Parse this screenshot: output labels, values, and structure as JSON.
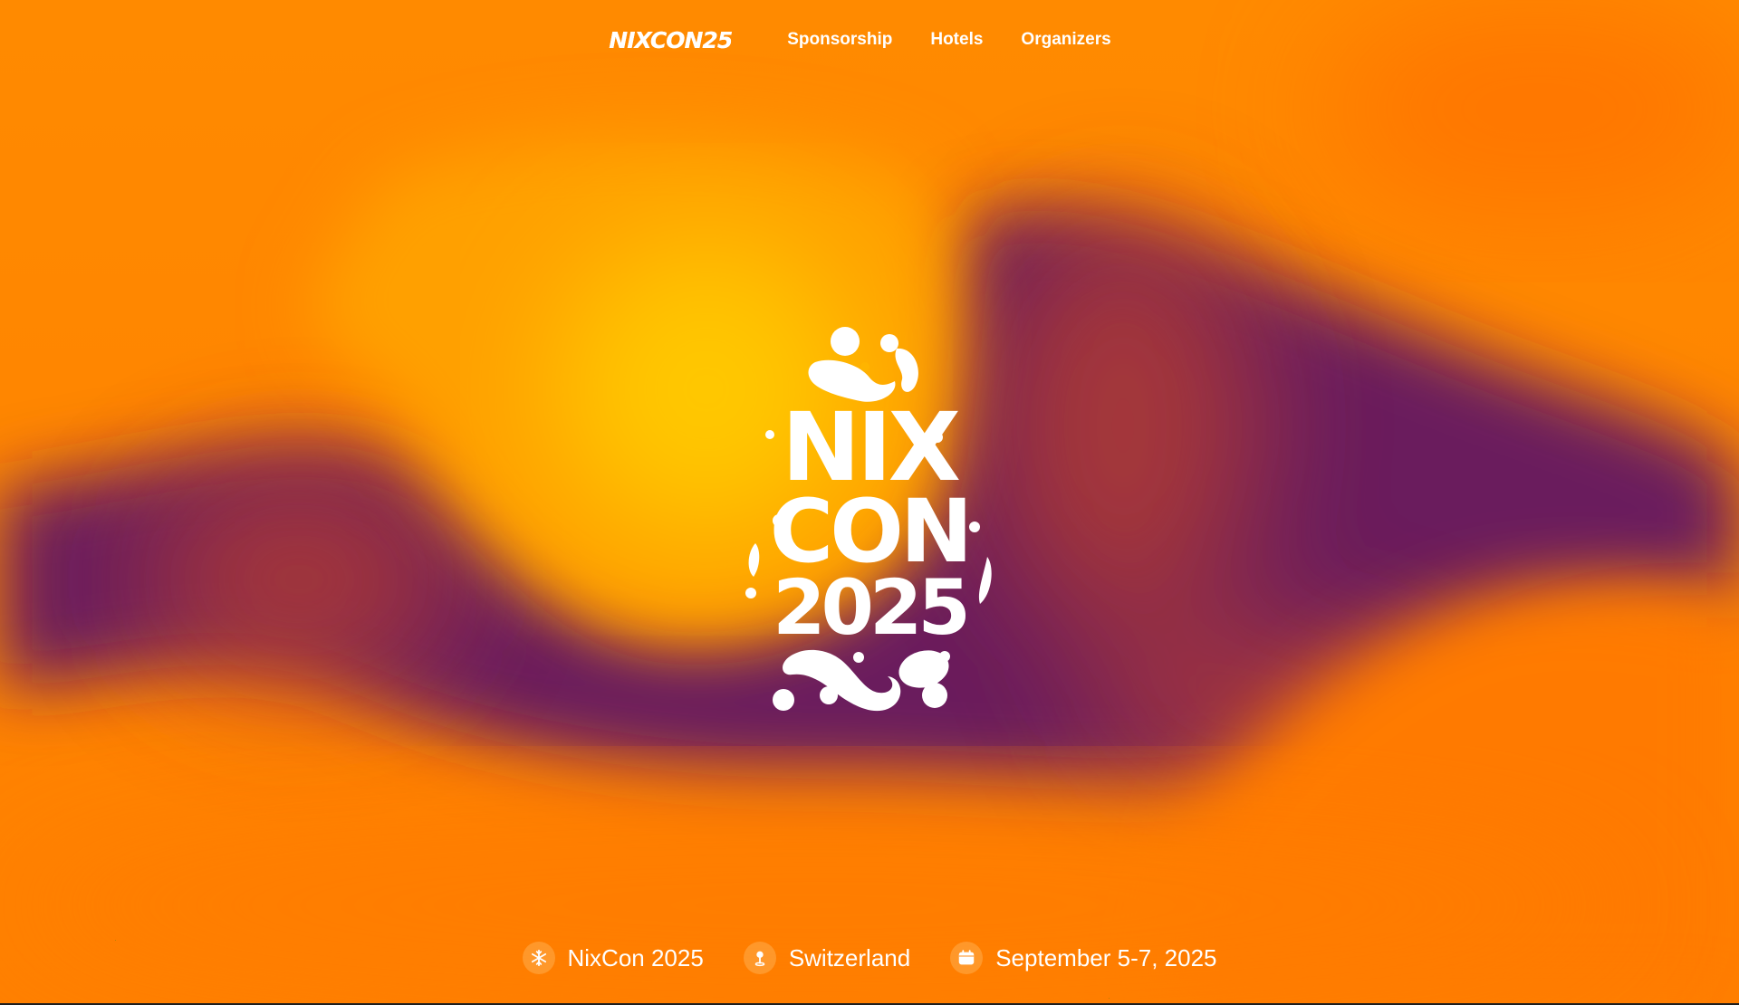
{
  "nav": {
    "logo_text": "NIXCON25",
    "links": [
      {
        "label": "Sponsorship"
      },
      {
        "label": "Hotels"
      },
      {
        "label": "Organizers"
      }
    ]
  },
  "hero": {
    "logo_lines": [
      "NIX",
      "CON",
      "2025"
    ]
  },
  "info": {
    "items": [
      {
        "label": "NixCon 2025",
        "icon": "snowflake-icon"
      },
      {
        "label": "Switzerland",
        "icon": "map-pin-icon"
      },
      {
        "label": "September 5-7, 2025",
        "icon": "calendar-icon"
      }
    ]
  },
  "colors": {
    "orange": "#ff7f00",
    "yellow": "#ffc400",
    "purple": "#6a1f5c",
    "text": "#ffffff"
  }
}
